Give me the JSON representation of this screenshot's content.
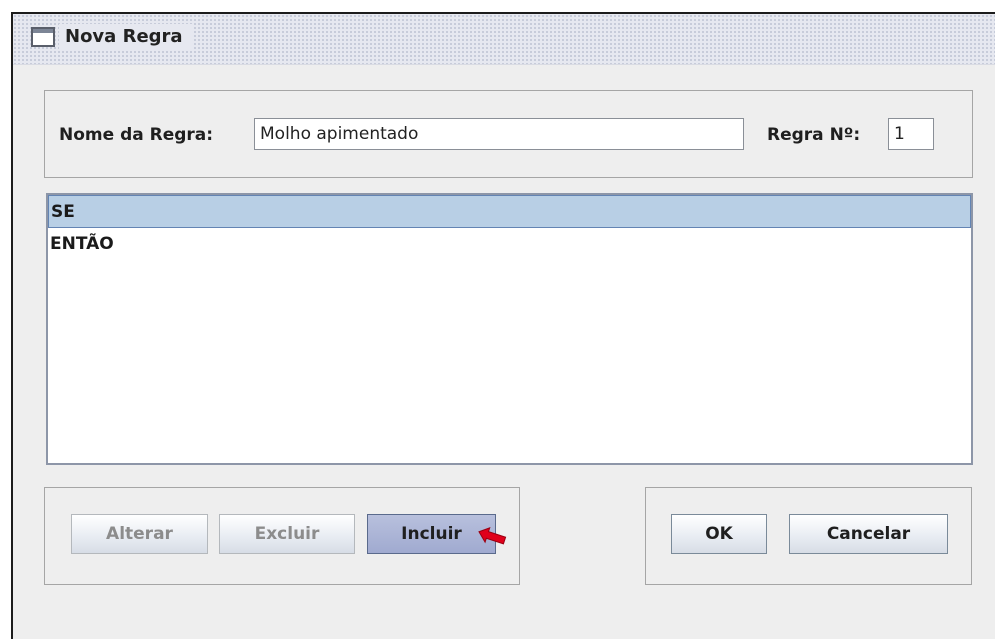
{
  "window": {
    "title": "Nova Regra"
  },
  "form": {
    "rule_name_label": "Nome da Regra:",
    "rule_name_value": "Molho apimentado",
    "rule_number_label": "Regra Nº:",
    "rule_number_value": "1"
  },
  "rule_list": {
    "items": [
      {
        "label": "SE",
        "selected": true
      },
      {
        "label": "ENTÃO",
        "selected": false
      }
    ]
  },
  "buttons": {
    "alterar": "Alterar",
    "excluir": "Excluir",
    "incluir": "Incluir",
    "ok": "OK",
    "cancelar": "Cancelar"
  },
  "icons": {
    "window": "window-icon",
    "pointer": "red-arrow-icon"
  },
  "colors": {
    "selection": "#b8cfe5",
    "arrow": "#e0001b"
  }
}
